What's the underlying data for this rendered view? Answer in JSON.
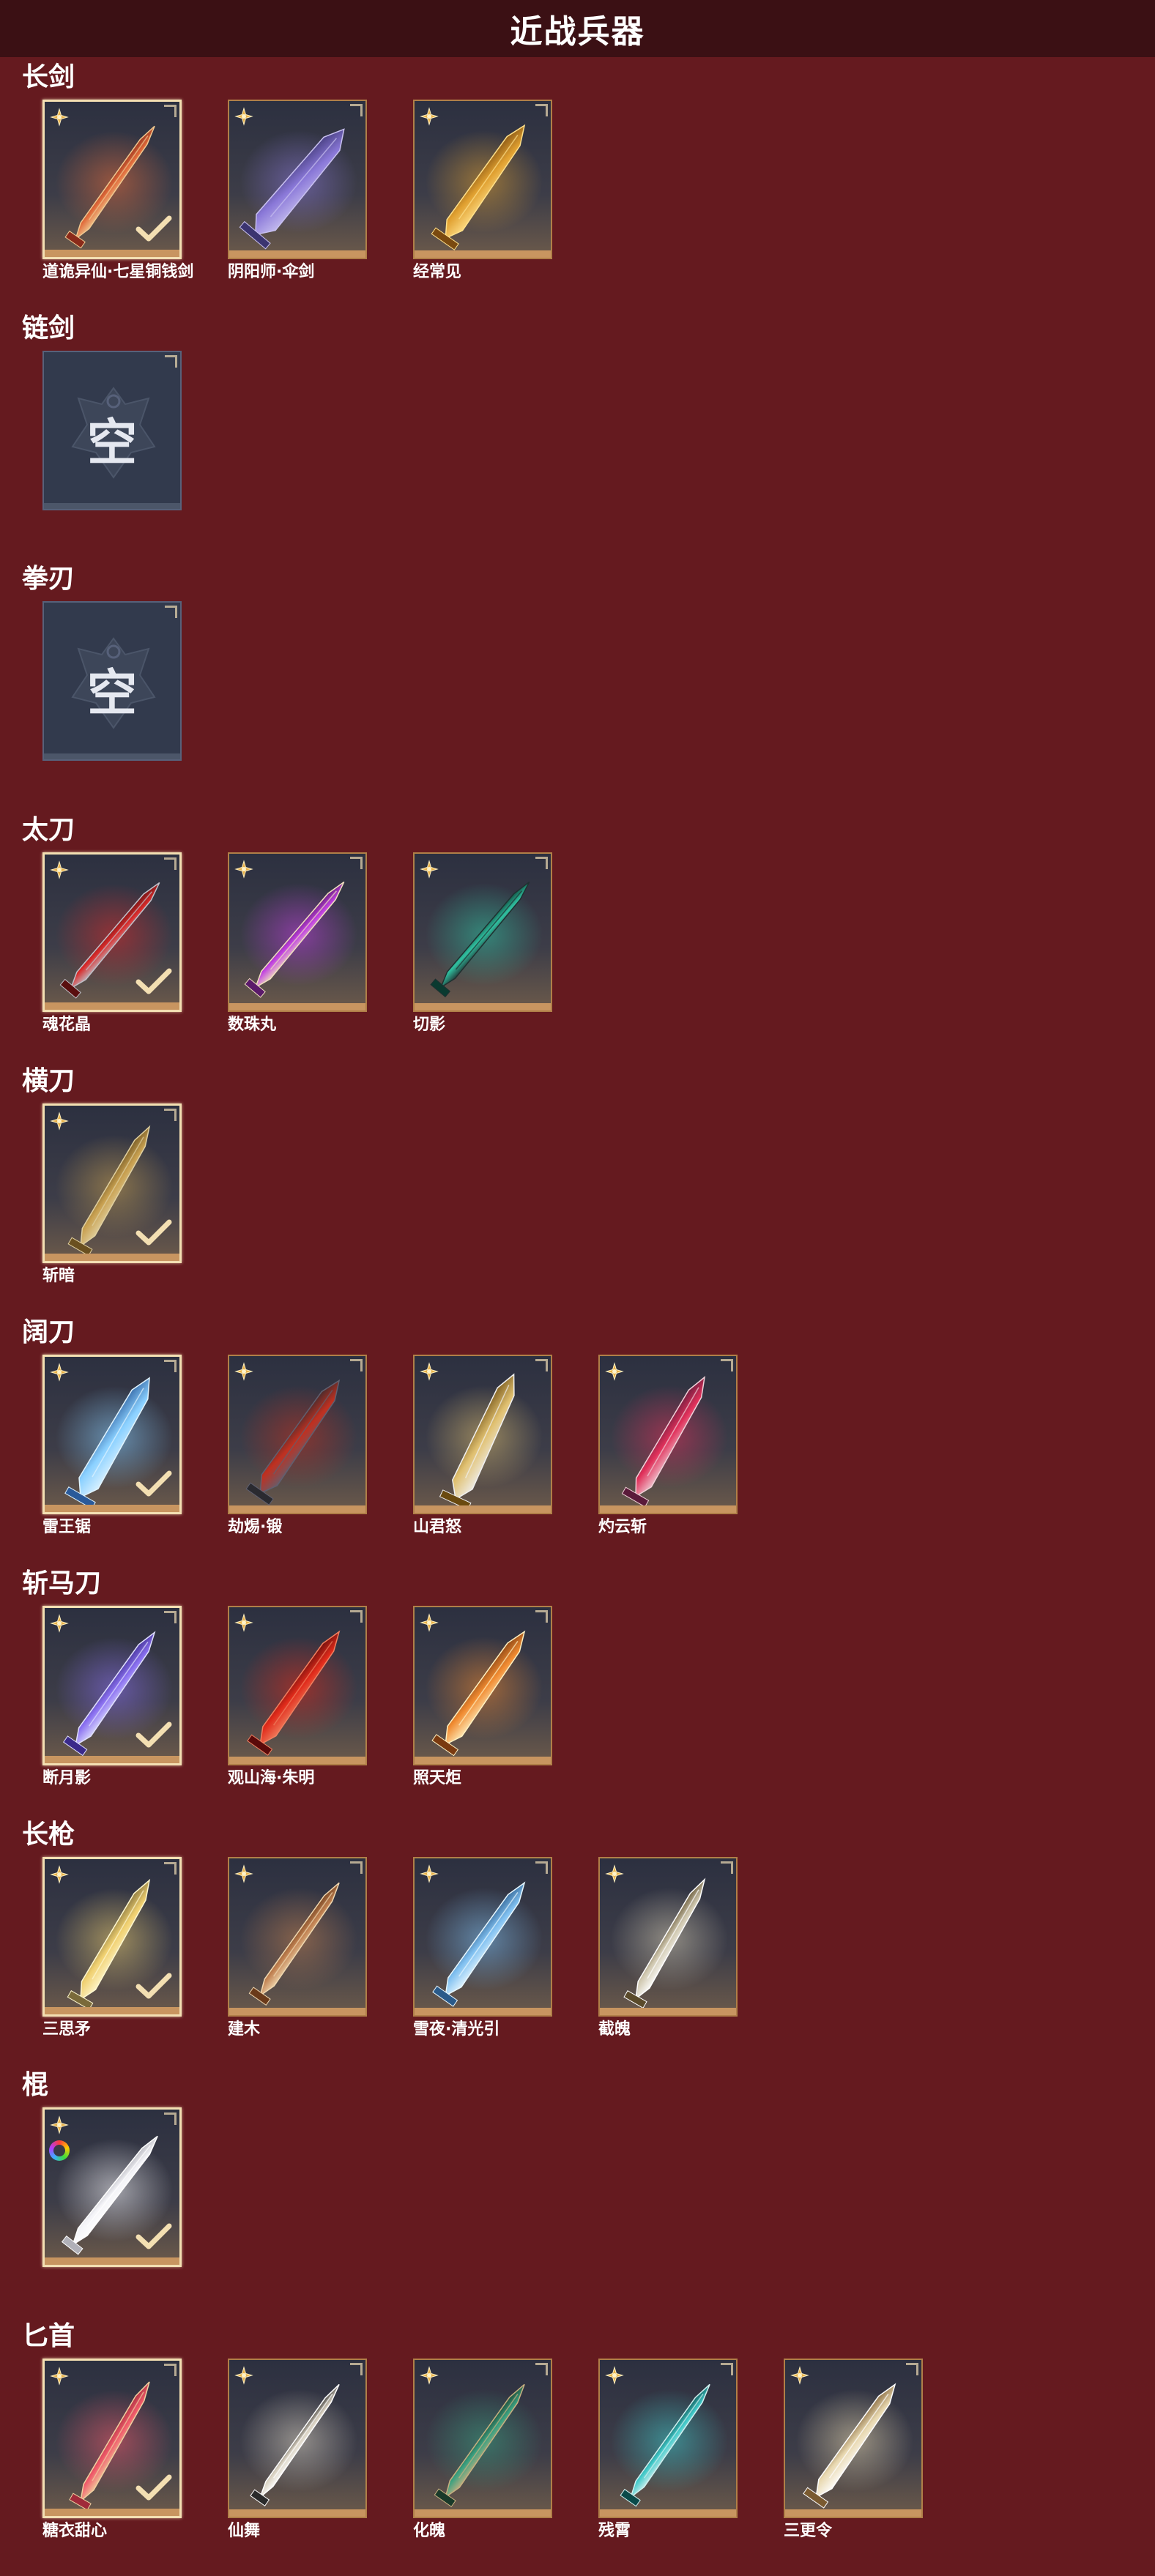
{
  "header": {
    "title": "近战兵器"
  },
  "sections": [
    {
      "title": "长剑",
      "items": [
        {
          "name": "道诡异仙·七星铜钱剑",
          "selected": true,
          "art": "sword-red"
        },
        {
          "name": "阴阳师·伞剑",
          "selected": false,
          "art": "umbrella"
        },
        {
          "name": "经常见",
          "selected": false,
          "art": "sword-gold"
        }
      ]
    },
    {
      "title": "链剑",
      "items": [
        {
          "name": "",
          "empty": true,
          "empty_label": "空"
        }
      ]
    },
    {
      "title": "拳刃",
      "items": [
        {
          "name": "",
          "empty": true,
          "empty_label": "空"
        }
      ]
    },
    {
      "title": "太刀",
      "items": [
        {
          "name": "魂花晶",
          "selected": true,
          "art": "katana-red"
        },
        {
          "name": "数珠丸",
          "selected": false,
          "art": "katana-purple"
        },
        {
          "name": "切影",
          "selected": false,
          "art": "katana-green"
        }
      ]
    },
    {
      "title": "横刀",
      "items": [
        {
          "name": "斩暗",
          "selected": true,
          "art": "blade-gold"
        }
      ]
    },
    {
      "title": "阔刀",
      "items": [
        {
          "name": "雷王锯",
          "selected": true,
          "art": "broad-blue"
        },
        {
          "name": "劫焬·锻",
          "selected": false,
          "art": "broad-dark"
        },
        {
          "name": "山君怒",
          "selected": false,
          "art": "broad-gold"
        },
        {
          "name": "灼云斩",
          "selected": false,
          "art": "broad-pink"
        }
      ]
    },
    {
      "title": "斩马刀",
      "items": [
        {
          "name": "断月影",
          "selected": true,
          "art": "zhanma-purple"
        },
        {
          "name": "观山海·朱明",
          "selected": false,
          "art": "zhanma-red"
        },
        {
          "name": "照天炬",
          "selected": false,
          "art": "zhanma-orange"
        }
      ]
    },
    {
      "title": "长枪",
      "items": [
        {
          "name": "三思矛",
          "selected": true,
          "art": "spear-gold"
        },
        {
          "name": "建木",
          "selected": false,
          "art": "spear-wood"
        },
        {
          "name": "雪夜·清光引",
          "selected": false,
          "art": "spear-ice"
        },
        {
          "name": "截魄",
          "selected": false,
          "art": "spear-silver"
        }
      ]
    },
    {
      "title": "棍",
      "items": [
        {
          "name": "",
          "selected": true,
          "art": "staff-white",
          "rainbow": true
        }
      ]
    },
    {
      "title": "匕首",
      "items": [
        {
          "name": "糖衣甜心",
          "selected": true,
          "art": "dagger-candy"
        },
        {
          "name": "仙舞",
          "selected": false,
          "art": "dagger-silver"
        },
        {
          "name": "化魄",
          "selected": false,
          "art": "dagger-green"
        },
        {
          "name": "残霄",
          "selected": false,
          "art": "dagger-teal"
        },
        {
          "name": "三更令",
          "selected": false,
          "art": "dagger-ivory"
        }
      ]
    }
  ],
  "colors": {
    "background": "#651a1f",
    "header": "#3b1014",
    "tile_border": "#b07f48",
    "selected_border": "#f3dfb2"
  }
}
